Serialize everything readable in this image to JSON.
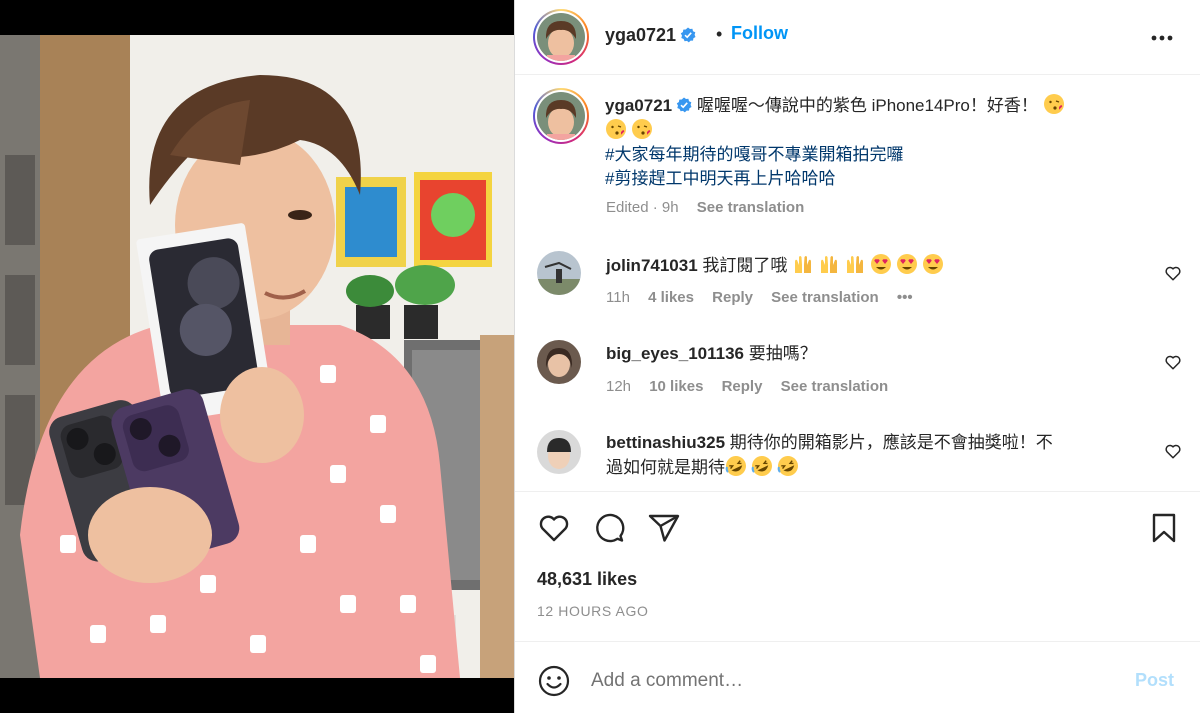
{
  "post": {
    "username": "yga0721",
    "follow_label": "Follow",
    "dot": "•",
    "icons": {
      "verified": "verified-badge-icon",
      "more": "more-options-icon",
      "like": "heart-icon",
      "comment": "comment-icon",
      "share": "share-icon",
      "save": "bookmark-icon",
      "emoji": "emoji-icon"
    },
    "colors": {
      "accent": "#0095f6",
      "hashtag": "#00376b",
      "muted": "#8e8e8e",
      "post_disabled": "#b2dffc"
    }
  },
  "caption": {
    "username": "yga0721",
    "text": "喔喔喔～傳說中的紫色 iPhone14Pro！好香！",
    "hashtag1": "#大家每年期待的嘎哥不專業開箱拍完囉",
    "hashtag2": "#剪接趕工中明天再上片哈哈哈",
    "edited": "Edited · 9h",
    "see_translation": "See translation"
  },
  "comments": [
    {
      "username": "jolin741031",
      "text": "我訂閱了哦",
      "time": "11h",
      "likes": "4 likes",
      "reply": "Reply",
      "see_translation": "See translation",
      "more": "•••"
    },
    {
      "username": "big_eyes_101136",
      "text": "要抽嗎？",
      "time": "12h",
      "likes": "10 likes",
      "reply": "Reply",
      "see_translation": "See translation"
    },
    {
      "username": "bettinashiu325",
      "text": "期待你的開箱影片，應該是不會抽獎啦！不",
      "text2": "過如何就是期待"
    }
  ],
  "footer": {
    "likes": "48,631 likes",
    "time_ago": "12 HOURS AGO",
    "comment_placeholder": "Add a comment…",
    "post_label": "Post"
  }
}
